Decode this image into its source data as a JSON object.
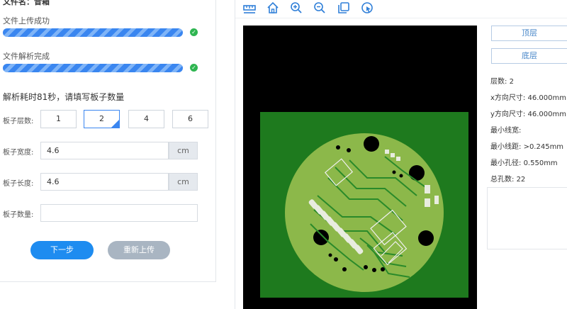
{
  "left": {
    "file_name": "文件名：音箱",
    "upload_status": "文件上传成功",
    "parse_status": "文件解析完成",
    "parse_note": "解析耗时81秒，请填写板子数量",
    "layers_label": "板子层数:",
    "layer_options": [
      "1",
      "2",
      "4",
      "6"
    ],
    "selected_layer": "2",
    "width_label": "板子宽度:",
    "width_value": "4.6",
    "width_unit": "cm",
    "length_label": "板子长度:",
    "length_value": "4.6",
    "length_unit": "cm",
    "quantity_label": "板子数量:",
    "quantity_value": "",
    "next_button": "下一步",
    "reupload_button": "重新上传",
    "upload_progress": 1.0,
    "parse_progress": 1.0
  },
  "right": {
    "toolbar_icons": [
      "ruler-icon",
      "home-icon",
      "zoom-in-icon",
      "zoom-out-icon",
      "copy-icon",
      "cursor-icon"
    ],
    "top_layer_tab": "顶层",
    "bottom_layer_tab": "底层",
    "layer_count_label": "层数:",
    "layer_count_value": "2",
    "x_size_label": "x方向尺寸:",
    "x_size_value": "46.000mm",
    "y_size_label": "y方向尺寸:",
    "y_size_value": "46.000mm",
    "min_trace_width_label": "最小线宽:",
    "min_trace_width_value": "",
    "min_trace_spacing_label": "最小线距:",
    "min_trace_spacing_value": ">0.245mm",
    "min_hole_label": "最小孔径:",
    "min_hole_value": "0.550mm",
    "total_holes_label": "总孔数:",
    "total_holes_value": "22"
  },
  "colors": {
    "accent": "#1e8cf0",
    "progress": "#3a86f0",
    "success": "#2fb551",
    "board_green": "#1e7a1e",
    "pcb_copper": "#8cb84a"
  }
}
